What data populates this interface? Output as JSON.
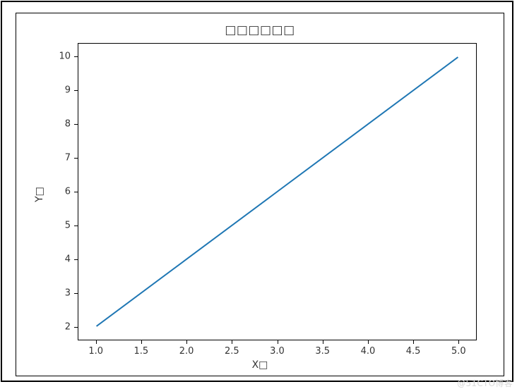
{
  "chart_data": {
    "type": "line",
    "title": "□□□□□□",
    "xlabel": "X□",
    "ylabel": "Y□",
    "x": [
      1,
      2,
      3,
      4,
      5
    ],
    "y": [
      2,
      4,
      6,
      8,
      10
    ],
    "xlim": [
      1.0,
      5.0
    ],
    "ylim": [
      2,
      10
    ],
    "xticks": [
      1.0,
      1.5,
      2.0,
      2.5,
      3.0,
      3.5,
      4.0,
      4.5,
      5.0
    ],
    "xtick_labels": [
      "1.0",
      "1.5",
      "2.0",
      "2.5",
      "3.0",
      "3.5",
      "4.0",
      "4.5",
      "5.0"
    ],
    "yticks": [
      2,
      3,
      4,
      5,
      6,
      7,
      8,
      9,
      10
    ],
    "ytick_labels": [
      "2",
      "3",
      "4",
      "5",
      "6",
      "7",
      "8",
      "9",
      "10"
    ],
    "line_color": "#1f77b4",
    "grid": false
  },
  "watermark": "@51CTO博客"
}
